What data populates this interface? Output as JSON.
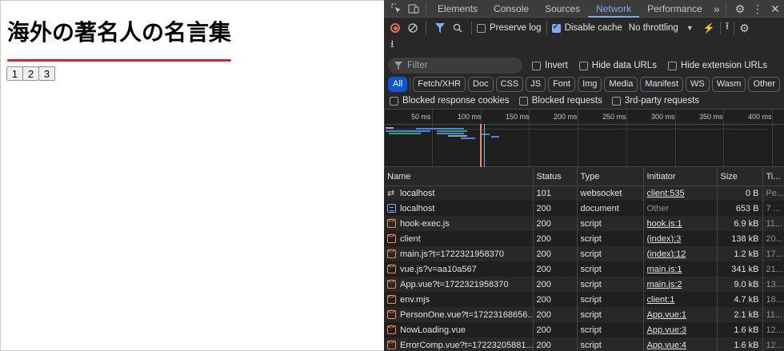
{
  "page": {
    "heading": "海外の著名人の名言集",
    "pager": [
      "1",
      "2",
      "3"
    ],
    "accent_color": "#d9262a"
  },
  "devtools": {
    "tabs": [
      "Elements",
      "Console",
      "Sources",
      "Network",
      "Performance"
    ],
    "active_tab": "Network",
    "overflow_glyph": "»",
    "toolbar": {
      "preserve_log": "Preserve log",
      "disable_cache": "Disable cache",
      "throttling": "No throttling"
    },
    "filter": {
      "placeholder": "Filter",
      "invert": "Invert",
      "hide_data_urls": "Hide data URLs",
      "hide_extension_urls": "Hide extension URLs"
    },
    "types": [
      "All",
      "Fetch/XHR",
      "Doc",
      "CSS",
      "JS",
      "Font",
      "Img",
      "Media",
      "Manifest",
      "WS",
      "Wasm",
      "Other"
    ],
    "blocked": {
      "cookies": "Blocked response cookies",
      "requests": "Blocked requests",
      "third_party": "3rd-party requests"
    },
    "timeline_ticks": [
      "50 ms",
      "100 ms",
      "150 ms",
      "200 ms",
      "250 ms",
      "300 ms",
      "350 ms",
      "400 ms"
    ],
    "columns": [
      "Name",
      "Status",
      "Type",
      "Initiator",
      "Size",
      "Ti..."
    ],
    "requests": [
      {
        "icon": "websocket",
        "name": "localhost",
        "status": "101",
        "type": "websocket",
        "initiator": "client:535",
        "initiator_link": true,
        "size": "0 B",
        "time": "Pe..."
      },
      {
        "icon": "document",
        "name": "localhost",
        "status": "200",
        "type": "document",
        "initiator": "Other",
        "initiator_link": false,
        "size": "653 B",
        "time": "7 ..."
      },
      {
        "icon": "script",
        "name": "hook-exec.js",
        "status": "200",
        "type": "script",
        "initiator": "hook.js:1",
        "initiator_link": true,
        "size": "6.9 kB",
        "time": "11..."
      },
      {
        "icon": "script",
        "name": "client",
        "status": "200",
        "type": "script",
        "initiator": "(index):3",
        "initiator_link": true,
        "size": "138 kB",
        "time": "20..."
      },
      {
        "icon": "script",
        "name": "main.js?t=1722321958370",
        "status": "200",
        "type": "script",
        "initiator": "(index):12",
        "initiator_link": true,
        "size": "1.2 kB",
        "time": "17..."
      },
      {
        "icon": "script",
        "name": "vue.js?v=aa10a567",
        "status": "200",
        "type": "script",
        "initiator": "main.js:1",
        "initiator_link": true,
        "size": "341 kB",
        "time": "21..."
      },
      {
        "icon": "script",
        "name": "App.vue?t=1722321958370",
        "status": "200",
        "type": "script",
        "initiator": "main.js:2",
        "initiator_link": true,
        "size": "9.0 kB",
        "time": "13..."
      },
      {
        "icon": "script",
        "name": "env.mjs",
        "status": "200",
        "type": "script",
        "initiator": "client:1",
        "initiator_link": true,
        "size": "4.7 kB",
        "time": "18..."
      },
      {
        "icon": "script",
        "name": "PersonOne.vue?t=17223168656...",
        "status": "200",
        "type": "script",
        "initiator": "App.vue:1",
        "initiator_link": true,
        "size": "2.1 kB",
        "time": "11..."
      },
      {
        "icon": "script",
        "name": "NowLoading.vue",
        "status": "200",
        "type": "script",
        "initiator": "App.vue:3",
        "initiator_link": true,
        "size": "1.6 kB",
        "time": "12..."
      },
      {
        "icon": "script",
        "name": "ErrorComp.vue?t=17223205881...",
        "status": "200",
        "type": "script",
        "initiator": "App.vue:4",
        "initiator_link": true,
        "size": "1.6 kB",
        "time": "12..."
      }
    ]
  }
}
